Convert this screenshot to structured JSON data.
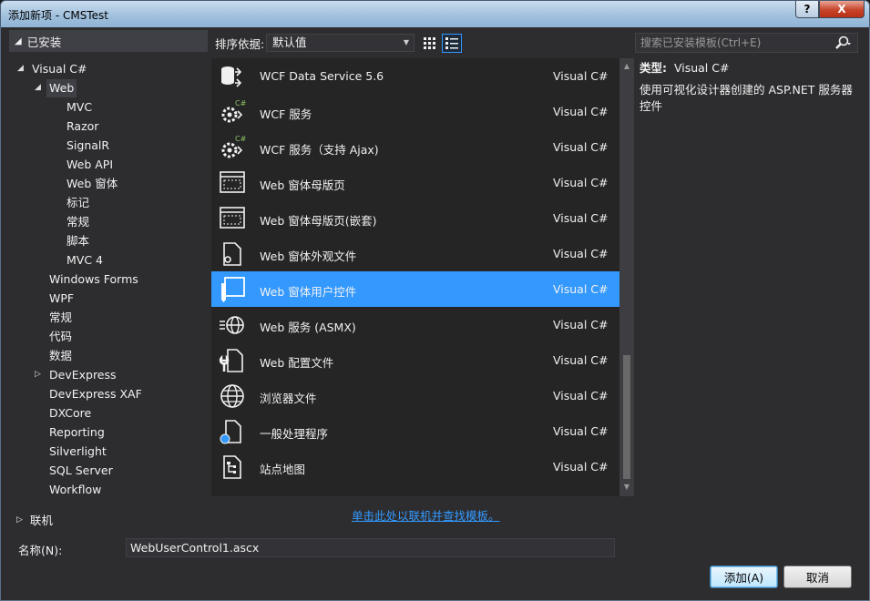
{
  "window": {
    "title": "添加新项 - CMSTest",
    "help_label": "?",
    "close_label": "X"
  },
  "sidebar": {
    "header": "已安装",
    "tree": [
      {
        "label": "Visual C#",
        "level": 0,
        "expanded": true
      },
      {
        "label": "Web",
        "level": 1,
        "expanded": true,
        "selected": true
      },
      {
        "label": "MVC",
        "level": 2
      },
      {
        "label": "Razor",
        "level": 2
      },
      {
        "label": "SignalR",
        "level": 2
      },
      {
        "label": "Web API",
        "level": 2
      },
      {
        "label": "Web 窗体",
        "level": 2
      },
      {
        "label": "标记",
        "level": 2
      },
      {
        "label": "常规",
        "level": 2
      },
      {
        "label": "脚本",
        "level": 2
      },
      {
        "label": "MVC 4",
        "level": 2
      },
      {
        "label": "Windows Forms",
        "level": 1
      },
      {
        "label": "WPF",
        "level": 1
      },
      {
        "label": "常规",
        "level": 1
      },
      {
        "label": "代码",
        "level": 1
      },
      {
        "label": "数据",
        "level": 1
      },
      {
        "label": "DevExpress",
        "level": 1,
        "collapsed": true
      },
      {
        "label": "DevExpress XAF",
        "level": 1
      },
      {
        "label": "DXCore",
        "level": 1
      },
      {
        "label": "Reporting",
        "level": 1
      },
      {
        "label": "Silverlight",
        "level": 1
      },
      {
        "label": "SQL Server",
        "level": 1
      },
      {
        "label": "Workflow",
        "level": 1
      }
    ],
    "online": "联机"
  },
  "toolbar": {
    "sort_label": "排序依据:",
    "sort_value": "默认值"
  },
  "search": {
    "placeholder": "搜索已安装模板(Ctrl+E)"
  },
  "templates": [
    {
      "name": "WCF Data Service 5.6",
      "lang": "Visual C#",
      "icon": "data-service-icon"
    },
    {
      "name": "WCF 服务",
      "lang": "Visual C#",
      "icon": "wcf-service-icon"
    },
    {
      "name": "WCF 服务（支持 Ajax)",
      "lang": "Visual C#",
      "icon": "wcf-ajax-service-icon"
    },
    {
      "name": "Web 窗体母版页",
      "lang": "Visual C#",
      "icon": "master-page-icon"
    },
    {
      "name": "Web 窗体母版页(嵌套)",
      "lang": "Visual C#",
      "icon": "nested-master-page-icon"
    },
    {
      "name": "Web 窗体外观文件",
      "lang": "Visual C#",
      "icon": "skin-file-icon"
    },
    {
      "name": "Web 窗体用户控件",
      "lang": "Visual C#",
      "icon": "user-control-icon",
      "selected": true
    },
    {
      "name": "Web 服务 (ASMX)",
      "lang": "Visual C#",
      "icon": "web-service-icon"
    },
    {
      "name": "Web 配置文件",
      "lang": "Visual C#",
      "icon": "config-file-icon"
    },
    {
      "name": "浏览器文件",
      "lang": "Visual C#",
      "icon": "browser-file-icon"
    },
    {
      "name": "一般处理程序",
      "lang": "Visual C#",
      "icon": "generic-handler-icon"
    },
    {
      "name": "站点地图",
      "lang": "Visual C#",
      "icon": "sitemap-icon"
    }
  ],
  "details": {
    "type_label": "类型:",
    "type_value": "Visual C#",
    "description": "使用可视化设计器创建的 ASP.NET 服务器控件"
  },
  "online_link": "单击此处以联机并查找模板。",
  "name_field": {
    "label": "名称(N):",
    "value": "WebUserControl1.ascx"
  },
  "buttons": {
    "add": "添加(A)",
    "cancel": "取消"
  },
  "colors": {
    "accent": "#3399ff",
    "background": "#2d2d30",
    "list_bg": "#252526"
  }
}
